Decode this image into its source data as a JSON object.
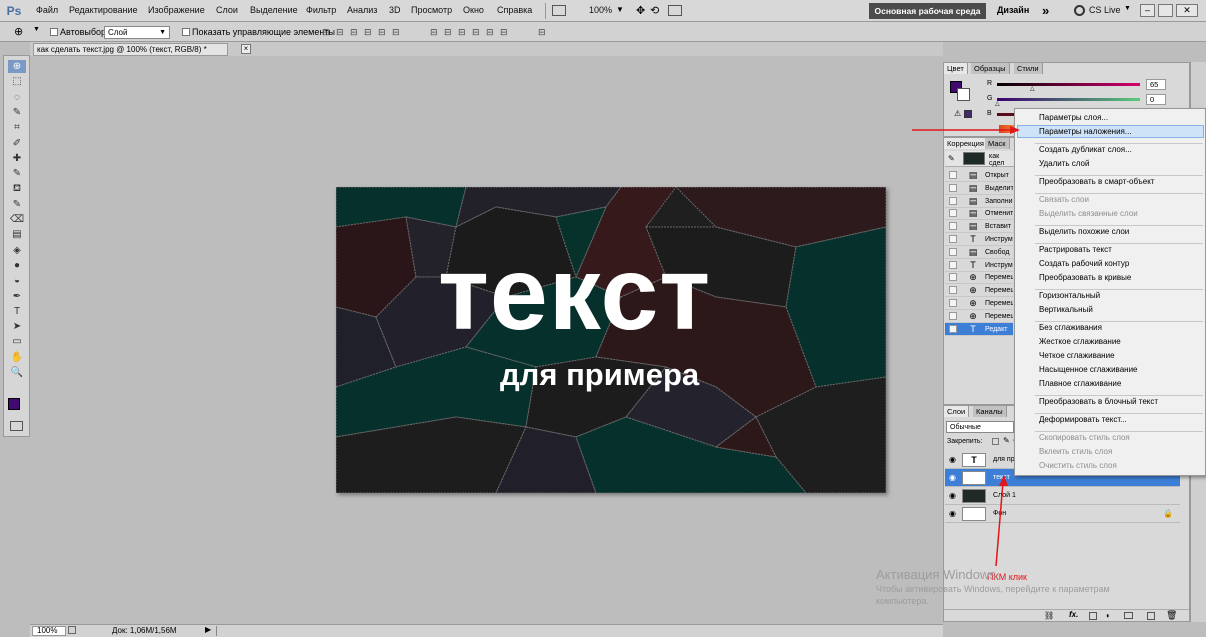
{
  "app": {
    "logo": "Ps"
  },
  "menu": [
    "Файл",
    "Редактирование",
    "Изображение",
    "Слои",
    "Выделение",
    "Фильтр",
    "Анализ",
    "3D",
    "Просмотр",
    "Окно",
    "Справка"
  ],
  "menubar": {
    "zoom": "100%",
    "workspace": "Основная рабочая среда",
    "design": "Дизайн",
    "more": "»",
    "cslive": "CS Live"
  },
  "options": {
    "autoselect_label": "Автовыбор:",
    "autoselect_value": "Слой",
    "show_controls": "Показать управляющие элементы"
  },
  "document": {
    "tab_title": "как сделать текст.jpg @ 100% (текст, RGB/8) *",
    "close": "×"
  },
  "canvas_art": {
    "main_text": "текст",
    "sub_text": "для примера"
  },
  "status": {
    "zoom": "100%",
    "doc_info": "Док: 1,06M/1,56M"
  },
  "color_panel": {
    "tabs": [
      "Цвет",
      "Образцы",
      "Стили"
    ],
    "r_label": "R",
    "r_value": "65",
    "g_label": "G",
    "g_value": "0",
    "b_label": "B",
    "fg_color": "#410a70"
  },
  "adjust_panel": {
    "tabs": [
      "Коррекция",
      "Маск"
    ]
  },
  "history": {
    "snapshot": "как сдел",
    "items": [
      {
        "icon": "doc",
        "label": "Открыт"
      },
      {
        "icon": "doc",
        "label": "Выделит"
      },
      {
        "icon": "doc",
        "label": "Заполни"
      },
      {
        "icon": "doc",
        "label": "Отменит"
      },
      {
        "icon": "doc",
        "label": "Вставит"
      },
      {
        "icon": "T",
        "label": "Инструм"
      },
      {
        "icon": "doc",
        "label": "Свобод"
      },
      {
        "icon": "T",
        "label": "Инструм"
      },
      {
        "icon": "move",
        "label": "Перемещ"
      },
      {
        "icon": "move",
        "label": "Перемещ"
      },
      {
        "icon": "move",
        "label": "Перемещ"
      },
      {
        "icon": "move",
        "label": "Перемещ"
      },
      {
        "icon": "T",
        "label": "Редакт"
      }
    ]
  },
  "layers_panel": {
    "tabs": [
      "Слои",
      "Каналы"
    ],
    "blend_mode": "Обычные",
    "lock_label": "Закрепить:",
    "layers": [
      {
        "name": "для пр",
        "thumb": "T"
      },
      {
        "name": "текст",
        "thumb": "T",
        "selected": true
      },
      {
        "name": "Слой 1",
        "thumb": ""
      },
      {
        "name": "Фон",
        "thumb": "",
        "locked": true
      }
    ]
  },
  "context_menu": {
    "items": [
      {
        "label": "Параметры слоя...",
        "disabled": false
      },
      {
        "label": "Параметры наложения...",
        "disabled": false,
        "highlighted": true
      },
      {
        "sep": true
      },
      {
        "label": "Создать дубликат слоя...",
        "disabled": false
      },
      {
        "label": "Удалить слой",
        "disabled": false
      },
      {
        "sep": true
      },
      {
        "label": "Преобразовать в смарт-объект",
        "disabled": false
      },
      {
        "sep": true
      },
      {
        "label": "Связать слои",
        "disabled": true
      },
      {
        "label": "Выделить связанные слои",
        "disabled": true
      },
      {
        "sep": true
      },
      {
        "label": "Выделить похожие слои",
        "disabled": false
      },
      {
        "sep": true
      },
      {
        "label": "Растрировать текст",
        "disabled": false
      },
      {
        "label": "Создать рабочий контур",
        "disabled": false
      },
      {
        "label": "Преобразовать в кривые",
        "disabled": false
      },
      {
        "sep": true
      },
      {
        "label": "Горизонтальный",
        "disabled": false
      },
      {
        "label": "Вертикальный",
        "disabled": false
      },
      {
        "sep": true
      },
      {
        "label": "Без сглаживания",
        "disabled": false
      },
      {
        "label": "Жесткое сглаживание",
        "disabled": false
      },
      {
        "label": "Четкое сглаживание",
        "disabled": false
      },
      {
        "label": "Насыщенное сглаживание",
        "disabled": false
      },
      {
        "label": "Плавное сглаживание",
        "disabled": false
      },
      {
        "sep": true
      },
      {
        "label": "Преобразовать в блочный текст",
        "disabled": false
      },
      {
        "sep": true
      },
      {
        "label": "Деформировать текст...",
        "disabled": false
      },
      {
        "sep": true
      },
      {
        "label": "Скопировать стиль слоя",
        "disabled": true
      },
      {
        "label": "Вклеить стиль слоя",
        "disabled": true
      },
      {
        "label": "Очистить стиль слоя",
        "disabled": true
      }
    ]
  },
  "annotation": {
    "label": "ПКМ клик",
    "color": "#e0161c"
  },
  "watermark": {
    "line1": "Активация Windows",
    "line2": "Чтобы активировать Windows, перейдите к параметрам",
    "line3": "компьютера."
  }
}
